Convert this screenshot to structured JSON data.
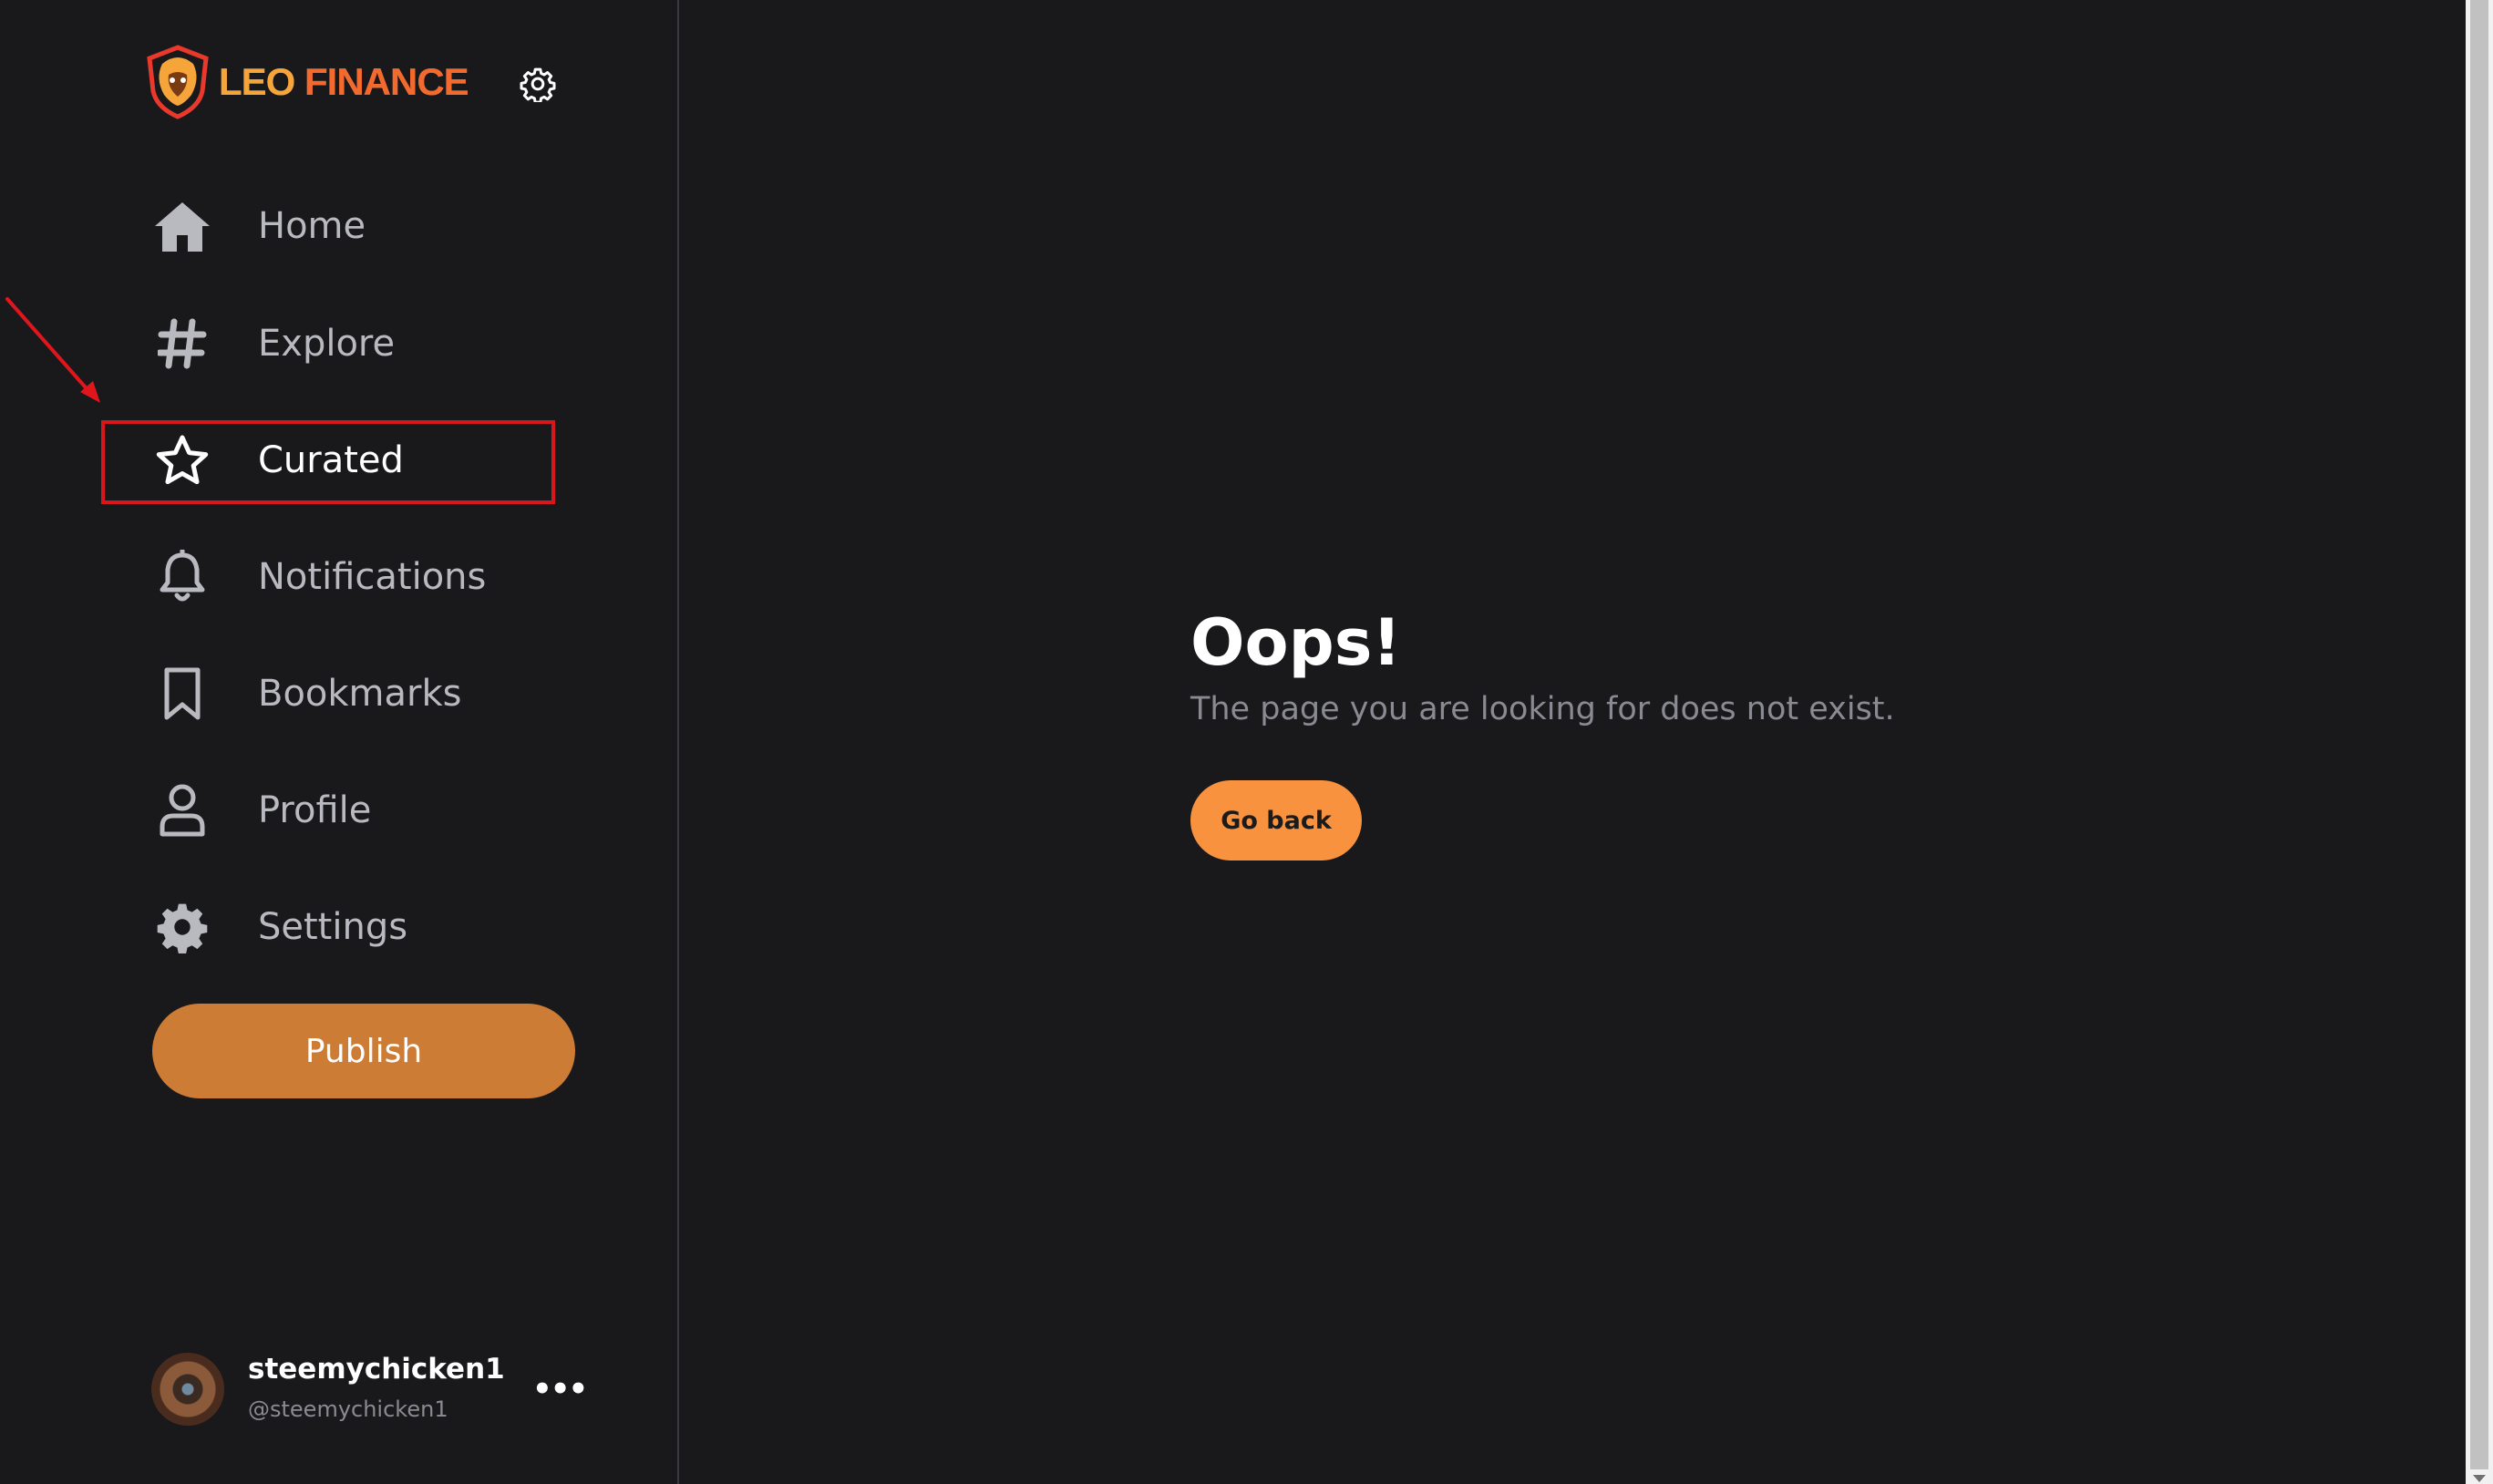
{
  "brand": {
    "logo_leo": "LEO",
    "logo_finance": "FINANCE",
    "accent": "#f9923f"
  },
  "sidebar": {
    "items": [
      {
        "label": "Home",
        "icon": "home-icon"
      },
      {
        "label": "Explore",
        "icon": "hashtag-icon"
      },
      {
        "label": "Curated",
        "icon": "star-icon",
        "active": true
      },
      {
        "label": "Notifications",
        "icon": "bell-icon"
      },
      {
        "label": "Bookmarks",
        "icon": "bookmark-icon"
      },
      {
        "label": "Profile",
        "icon": "user-icon"
      },
      {
        "label": "Settings",
        "icon": "gear-icon"
      }
    ],
    "publish_label": "Publish"
  },
  "user": {
    "name": "steemychicken1",
    "handle": "@steemychicken1",
    "more": "•••"
  },
  "main": {
    "title": "Oops!",
    "message": "The page you are looking for does not exist.",
    "go_back_label": "Go back"
  },
  "annotation": {
    "highlight_color": "#d9161c"
  }
}
